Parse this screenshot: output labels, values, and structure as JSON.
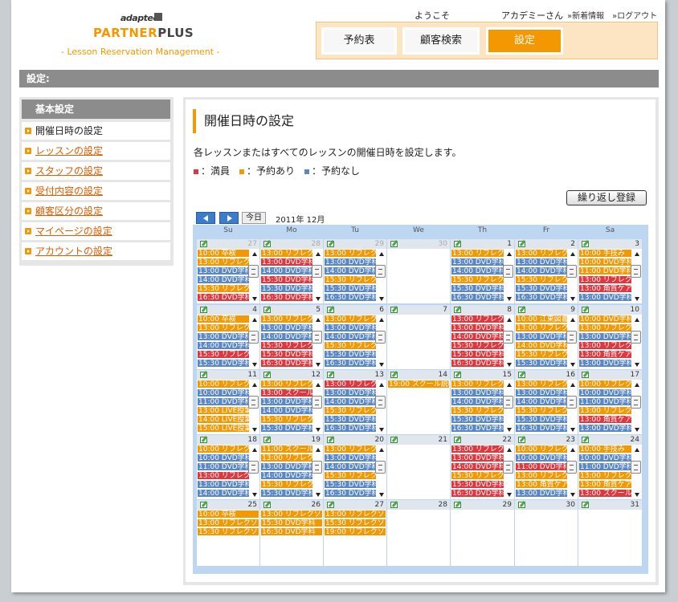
{
  "header": {
    "logo_brand": "adaptec",
    "logo_partner": "PARTNER",
    "logo_plus": "PLUS",
    "logo_subtitle": "- Lesson Reservation Management -",
    "welcome": "ようこそ",
    "user_name": "アカデミーさん",
    "news_link": "»新着情報",
    "logout_link": "»ログアウト",
    "nav": [
      {
        "label": "予約表",
        "active": false
      },
      {
        "label": "顧客検索",
        "active": false
      },
      {
        "label": "設定",
        "active": true
      }
    ]
  },
  "title_bar": "設定:",
  "sidebar": {
    "title": "基本設定",
    "items": [
      {
        "label": "開催日時の設定",
        "active": true
      },
      {
        "label": "レッスンの設定",
        "active": false
      },
      {
        "label": "スタッフの設定",
        "active": false
      },
      {
        "label": "受付内容の設定",
        "active": false
      },
      {
        "label": "顧客区分の設定",
        "active": false
      },
      {
        "label": "マイページの設定",
        "active": false
      },
      {
        "label": "アカウントの設定",
        "active": false
      }
    ]
  },
  "main": {
    "heading": "開催日時の設定",
    "description": "各レッスンまたはすべてのレッスンの開催日時を設定します。",
    "legend": [
      {
        "label": "：満員",
        "color": "#e0373f"
      },
      {
        "label": "：予約あり",
        "color": "#f39800"
      },
      {
        "label": "：予約なし",
        "color": "#5a88c6"
      }
    ],
    "repeat_button": "繰り返し登録",
    "today_button": "今日",
    "month_label": "2011年 12月"
  },
  "calendar": {
    "weekdays": [
      "Su",
      "Mo",
      "Tu",
      "We",
      "Th",
      "Fr",
      "Sa"
    ],
    "weeks": [
      [
        {
          "day": "27",
          "other": true,
          "scroll": true,
          "events": [
            [
              "10:00 卒検",
              "some"
            ],
            [
              "13:00 リフレク",
              "some"
            ],
            [
              "13:00 DVD学科",
              "none"
            ],
            [
              "14:00 DVD学科",
              "none"
            ],
            [
              "15:30 リフレク",
              "some"
            ],
            [
              "16:30 DVD学科",
              "full"
            ]
          ]
        },
        {
          "day": "28",
          "other": true,
          "scroll": true,
          "events": [
            [
              "13:00 リフレク",
              "some"
            ],
            [
              "13:00 DVD学科",
              "full"
            ],
            [
              "14:00 DVD学科",
              "none"
            ],
            [
              "15:30 DVD学科",
              "full"
            ],
            [
              "15:30 DVD学科",
              "none"
            ],
            [
              "16:30 DVD学科",
              "full"
            ]
          ]
        },
        {
          "day": "29",
          "other": true,
          "scroll": true,
          "events": [
            [
              "13:00 リフレク",
              "some"
            ],
            [
              "13:00 DVD学科",
              "none"
            ],
            [
              "14:00 DVD学科",
              "none"
            ],
            [
              "15:30 リフレク",
              "some"
            ],
            [
              "15:30 DVD学科",
              "none"
            ],
            [
              "16:30 DVD学科",
              "none"
            ]
          ]
        },
        {
          "day": "30",
          "other": true,
          "scroll": false,
          "events": []
        },
        {
          "day": "1",
          "other": false,
          "scroll": true,
          "events": [
            [
              "13:00 リフレク",
              "some"
            ],
            [
              "13:00 DVD学科",
              "none"
            ],
            [
              "14:00 DVD学科",
              "none"
            ],
            [
              "15:30 リフレク",
              "some"
            ],
            [
              "15:30 DVD学科",
              "none"
            ],
            [
              "16:30 DVD学科",
              "none"
            ]
          ]
        },
        {
          "day": "2",
          "other": false,
          "scroll": true,
          "events": [
            [
              "13:00 リフレク",
              "some"
            ],
            [
              "13:00 DVD学科",
              "none"
            ],
            [
              "14:00 DVD学科",
              "none"
            ],
            [
              "15:30 リフレク",
              "some"
            ],
            [
              "15:30 DVD学科",
              "none"
            ],
            [
              "16:30 DVD学科",
              "none"
            ]
          ]
        },
        {
          "day": "3",
          "other": false,
          "scroll": true,
          "events": [
            [
              "10:00 手技み",
              "some"
            ],
            [
              "10:00 DVD学科",
              "some"
            ],
            [
              "11:00 DVD学科",
              "some"
            ],
            [
              "13:00 リフレク",
              "full"
            ],
            [
              "13:00 角質ケア",
              "full"
            ],
            [
              "13:00 DVD学科",
              "none"
            ]
          ]
        }
      ],
      [
        {
          "day": "4",
          "other": false,
          "scroll": true,
          "events": [
            [
              "10:00 卒検",
              "some"
            ],
            [
              "13:00 リフレク",
              "some"
            ],
            [
              "13:00 DVD学科",
              "none"
            ],
            [
              "14:00 DVD学科",
              "none"
            ],
            [
              "15:30 リフレク",
              "full"
            ],
            [
              "15:30 DVD学科",
              "none"
            ]
          ]
        },
        {
          "day": "5",
          "other": false,
          "scroll": true,
          "events": [
            [
              "13:00 リフレク",
              "some"
            ],
            [
              "13:00 DVD学科",
              "none"
            ],
            [
              "14:00 DVD学科",
              "none"
            ],
            [
              "15:30 リフレク",
              "full"
            ],
            [
              "15:30 DVD学科",
              "full"
            ],
            [
              "16:30 DVD学科",
              "full"
            ]
          ]
        },
        {
          "day": "6",
          "other": false,
          "scroll": true,
          "events": [
            [
              "13:00 リフレク",
              "some"
            ],
            [
              "13:00 DVD学科",
              "none"
            ],
            [
              "14:00 DVD学科",
              "none"
            ],
            [
              "15:30 リフレク",
              "some"
            ],
            [
              "15:30 DVD学科",
              "none"
            ],
            [
              "16:30 DVD学科",
              "none"
            ]
          ]
        },
        {
          "day": "7",
          "other": false,
          "scroll": false,
          "events": []
        },
        {
          "day": "8",
          "other": false,
          "scroll": true,
          "events": [
            [
              "13:00 リフレク",
              "full"
            ],
            [
              "13:00 DVD学科",
              "full"
            ],
            [
              "14:00 DVD学科",
              "full"
            ],
            [
              "15:30 リフレク",
              "full"
            ],
            [
              "15:30 DVD学科",
              "full"
            ],
            [
              "16:30 DVD学科",
              "full"
            ]
          ]
        },
        {
          "day": "9",
          "other": false,
          "scroll": true,
          "events": [
            [
              "10:00 江東図書",
              "some"
            ],
            [
              "13:00 リフレク",
              "some"
            ],
            [
              "13:00 DVD学科",
              "none"
            ],
            [
              "14:00 DVD学科",
              "some"
            ],
            [
              "15:30 リフレク",
              "some"
            ],
            [
              "15:30 DVD学科",
              "none"
            ]
          ]
        },
        {
          "day": "10",
          "other": false,
          "scroll": true,
          "events": [
            [
              "10:00 DVD学科",
              "some"
            ],
            [
              "13:00 リフレク",
              "some"
            ],
            [
              "13:00 DVD学科",
              "none"
            ],
            [
              "13:00 リフレク",
              "full"
            ],
            [
              "13:00 角質ケア",
              "full"
            ],
            [
              "13:00 DVD学科",
              "none"
            ]
          ]
        }
      ],
      [
        {
          "day": "11",
          "other": false,
          "scroll": true,
          "events": [
            [
              "10:00 リフレク",
              "some"
            ],
            [
              "10:00 DVD学科",
              "none"
            ],
            [
              "11:00 DVD学科",
              "none"
            ],
            [
              "13:00 LIVE授業",
              "some"
            ],
            [
              "14:00 LIVE授業",
              "some"
            ],
            [
              "15:00 LIVE授業",
              "some"
            ]
          ]
        },
        {
          "day": "12",
          "other": false,
          "scroll": true,
          "events": [
            [
              "13:00 リフレク",
              "some"
            ],
            [
              "13:00 スクール",
              "full"
            ],
            [
              "13:00 DVD学科",
              "none"
            ],
            [
              "14:00 DVD学科",
              "none"
            ],
            [
              "15:30 リフレク",
              "some"
            ],
            [
              "15:30 DVD学科",
              "none"
            ]
          ]
        },
        {
          "day": "13",
          "other": false,
          "scroll": true,
          "events": [
            [
              "13:00 リフレク",
              "full"
            ],
            [
              "13:00 DVD学科",
              "none"
            ],
            [
              "14:00 DVD学科",
              "none"
            ],
            [
              "15:30 リフレク",
              "some"
            ],
            [
              "15:30 DVD学科",
              "none"
            ],
            [
              "16:30 DVD学科",
              "none"
            ]
          ]
        },
        {
          "day": "14",
          "other": false,
          "scroll": false,
          "events": [
            [
              "19:00 スクール説明会",
              "some"
            ]
          ]
        },
        {
          "day": "15",
          "other": false,
          "scroll": true,
          "events": [
            [
              "13:00 リフレク",
              "some"
            ],
            [
              "13:00 DVD学科",
              "none"
            ],
            [
              "14:00 DVD学科",
              "none"
            ],
            [
              "15:30 リフレク",
              "some"
            ],
            [
              "15:30 DVD学科",
              "none"
            ],
            [
              "16:30 DVD学科",
              "none"
            ]
          ]
        },
        {
          "day": "16",
          "other": false,
          "scroll": true,
          "events": [
            [
              "13:00 リフレク",
              "some"
            ],
            [
              "13:00 DVD学科",
              "none"
            ],
            [
              "14:00 DVD学科",
              "none"
            ],
            [
              "15:30 リフレク",
              "some"
            ],
            [
              "15:30 DVD学科",
              "none"
            ],
            [
              "16:30 DVD学科",
              "none"
            ]
          ]
        },
        {
          "day": "17",
          "other": false,
          "scroll": true,
          "events": [
            [
              "10:00 リフレク",
              "some"
            ],
            [
              "10:00 DVD学科",
              "none"
            ],
            [
              "11:00 DVD学科",
              "none"
            ],
            [
              "13:00 リフレク",
              "some"
            ],
            [
              "13:00 角質ケア",
              "full"
            ],
            [
              "13:00 DVD学科",
              "none"
            ]
          ]
        }
      ],
      [
        {
          "day": "18",
          "other": false,
          "scroll": true,
          "events": [
            [
              "10:00 リフレク",
              "some"
            ],
            [
              "10:00 DVD学科",
              "none"
            ],
            [
              "11:00 DVD学科",
              "none"
            ],
            [
              "13:00 リフレク",
              "full"
            ],
            [
              "13:00 DVD学科",
              "none"
            ],
            [
              "14:00 DVD学科",
              "none"
            ]
          ]
        },
        {
          "day": "19",
          "other": false,
          "scroll": true,
          "events": [
            [
              "11:00 スクール",
              "some"
            ],
            [
              "13:00 リフレク",
              "some"
            ],
            [
              "13:00 DVD学科",
              "none"
            ],
            [
              "14:00 DVD学科",
              "none"
            ],
            [
              "15:30 リフレク",
              "some"
            ],
            [
              "15:30 DVD学科",
              "none"
            ]
          ]
        },
        {
          "day": "20",
          "other": false,
          "scroll": true,
          "events": [
            [
              "13:00 リフレク",
              "some"
            ],
            [
              "13:00 DVD学科",
              "none"
            ],
            [
              "14:00 DVD学科",
              "none"
            ],
            [
              "15:30 リフレク",
              "some"
            ],
            [
              "15:30 DVD学科",
              "none"
            ],
            [
              "16:30 DVD学科",
              "none"
            ]
          ]
        },
        {
          "day": "21",
          "other": false,
          "scroll": false,
          "events": []
        },
        {
          "day": "22",
          "other": false,
          "scroll": true,
          "events": [
            [
              "13:00 リフレク",
              "full"
            ],
            [
              "13:00 DVD学科",
              "full"
            ],
            [
              "14:00 DVD学科",
              "full"
            ],
            [
              "15:30 リフレク",
              "some"
            ],
            [
              "15:30 DVD学科",
              "full"
            ],
            [
              "16:30 DVD学科",
              "full"
            ]
          ]
        },
        {
          "day": "23",
          "other": false,
          "scroll": true,
          "events": [
            [
              "10:00 リフレク",
              "some"
            ],
            [
              "10:00 DVD学科",
              "none"
            ],
            [
              "11:00 DVD学科",
              "full"
            ],
            [
              "13:00 リフレク",
              "some"
            ],
            [
              "13:00 角質ケア",
              "some"
            ],
            [
              "13:00 DVD学科",
              "none"
            ]
          ]
        },
        {
          "day": "24",
          "other": false,
          "scroll": true,
          "events": [
            [
              "10:00 手技み",
              "some"
            ],
            [
              "10:00 DVD学科",
              "none"
            ],
            [
              "11:00 DVD学科",
              "none"
            ],
            [
              "13:00 リフレク",
              "some"
            ],
            [
              "13:00 角質ケア",
              "some"
            ],
            [
              "13:00 スクール",
              "full"
            ]
          ]
        }
      ],
      [
        {
          "day": "25",
          "other": false,
          "scroll": false,
          "events": [
            [
              "10:00 卒検",
              "some"
            ],
            [
              "13:00 リフレクソロジ",
              "some"
            ],
            [
              "15:30 リフレクソロジ",
              "some"
            ]
          ]
        },
        {
          "day": "26",
          "other": false,
          "scroll": false,
          "events": [
            [
              "13:00 リフレクソロジ",
              "some"
            ],
            [
              "15:30 DVD学科",
              "some"
            ],
            [
              "16:30 DVD学科",
              "some"
            ]
          ]
        },
        {
          "day": "27",
          "other": false,
          "scroll": false,
          "events": [
            [
              "13:00 リフレクソロジ",
              "some"
            ],
            [
              "15:30 リフレクソロジ",
              "some"
            ],
            [
              "19:00 リフレクソロジ",
              "some"
            ]
          ]
        },
        {
          "day": "28",
          "other": false,
          "scroll": false,
          "events": []
        },
        {
          "day": "29",
          "other": false,
          "scroll": false,
          "events": []
        },
        {
          "day": "30",
          "other": false,
          "scroll": false,
          "events": []
        },
        {
          "day": "31",
          "other": false,
          "scroll": false,
          "events": []
        }
      ]
    ]
  }
}
